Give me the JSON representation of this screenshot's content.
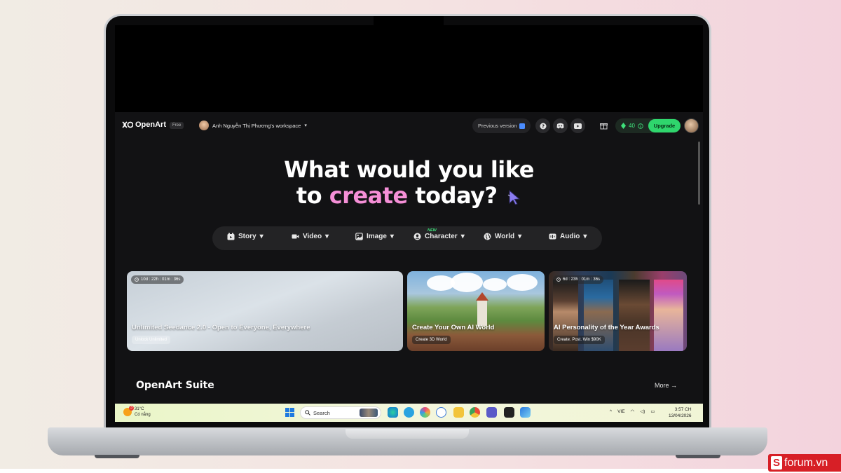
{
  "topbar": {
    "logo_text": "OpenArt",
    "plan_badge": "Free",
    "workspace_name": "Anh Nguyễn Thị Phương's workspace",
    "previous_version_label": "Previous version",
    "credits": "40",
    "upgrade_label": "Upgrade"
  },
  "hero": {
    "line1": "What would you like",
    "line2_prefix": "to",
    "line2_accent": "create",
    "line2_suffix": "today?"
  },
  "categories": [
    {
      "label": "Story",
      "icon": "story-icon"
    },
    {
      "label": "Video",
      "icon": "video-camera-icon"
    },
    {
      "label": "Image",
      "icon": "image-icon"
    },
    {
      "label": "Character",
      "icon": "character-icon"
    },
    {
      "label": "World",
      "icon": "globe-icon",
      "badge": "NEW"
    },
    {
      "label": "Audio",
      "icon": "audio-icon"
    }
  ],
  "cards": [
    {
      "timer": "10d : 22h : 01m : 36s",
      "title": "Unlimited Seedance 2.0 - Open to Everyone, Everywhere",
      "button": "Unlock Unlimited"
    },
    {
      "title": "Create Your Own AI World",
      "button": "Create 3D World"
    },
    {
      "timer": "6d : 23h : 01m : 36s",
      "title": "AI Personality of the Year Awards",
      "button": "Create. Post. Win $90K"
    }
  ],
  "suite": {
    "title": "OpenArt Suite",
    "more_label": "More →"
  },
  "taskbar": {
    "weather_temp": "31°C",
    "weather_desc": "Có nắng",
    "weather_badge": "3",
    "search_placeholder": "Search",
    "language": "VIE",
    "time": "3:57 CH",
    "date": "13/04/2026"
  },
  "watermark": {
    "mark": "S",
    "text": "forum.vn"
  },
  "colors": {
    "app_background": "#121214",
    "accent_pink": "#f58fd7",
    "upgrade_green": "#2fd66d",
    "credit_green": "#3ee07a"
  }
}
